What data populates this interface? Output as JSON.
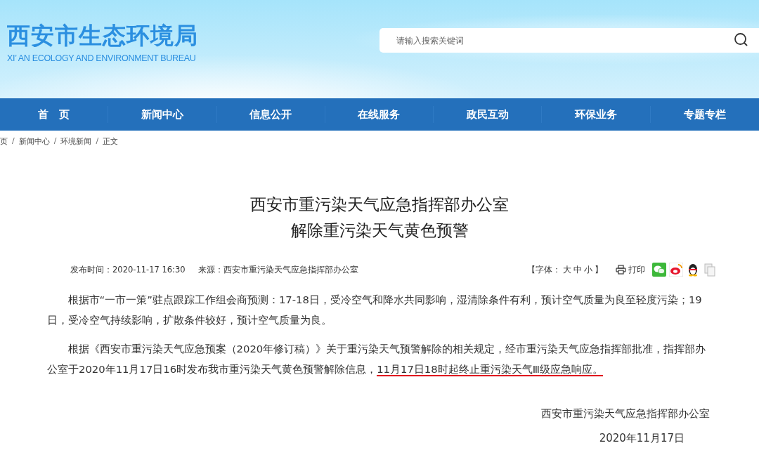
{
  "header": {
    "logo_title": "西安市生态环境局",
    "logo_subtitle": "XI’ AN ECOLOGY AND ENVIRONMENT BUREAU",
    "search": {
      "placeholder": "请输入搜索关键词"
    }
  },
  "nav": [
    {
      "label": "首　页"
    },
    {
      "label": "新闻中心"
    },
    {
      "label": "信息公开"
    },
    {
      "label": "在线服务"
    },
    {
      "label": "政民互动"
    },
    {
      "label": "环保业务"
    },
    {
      "label": "专题专栏"
    }
  ],
  "breadcrumb": {
    "separator": "/",
    "items": [
      "页",
      "新闻中心",
      "环境新闻",
      "正文"
    ]
  },
  "article": {
    "title_lines": [
      "西安市重污染天气应急指挥部办公室",
      "解除重污染天气黄色预警"
    ],
    "published": "发布时间：2020-11-17 16:30",
    "source": "来源：西安市重污染天气应急指挥部办公室",
    "font_size_label": "【字体：",
    "font_sizes": [
      "大",
      "中",
      "小"
    ],
    "font_size_end": "】",
    "print_label": "打印",
    "paragraphs": [
      {
        "text": "根据市“一市一策”驻点跟踪工作组会商预测：17-18日，受冷空气和降水共同影响，湿清除条件有利，预计空气质量为良至轻度污染；19日，受冷空气持续影响，扩散条件较好，预计空气质量为良。"
      },
      {
        "text": "根据《西安市重污染天气应急预案（2020年修订稿）》关于重污染天气预警解除的相关规定，经市重污染天气应急指挥部批准，指挥部办公室于2020年11月17日16时发布我市重污染天气黄色预警解除信息，",
        "underlined_text": "11月17日18时起终止重污染天气Ⅲ级应急响应。"
      }
    ],
    "signature": "西安市重污染天气应急指挥部办公室",
    "date": "2020年11月17日"
  }
}
